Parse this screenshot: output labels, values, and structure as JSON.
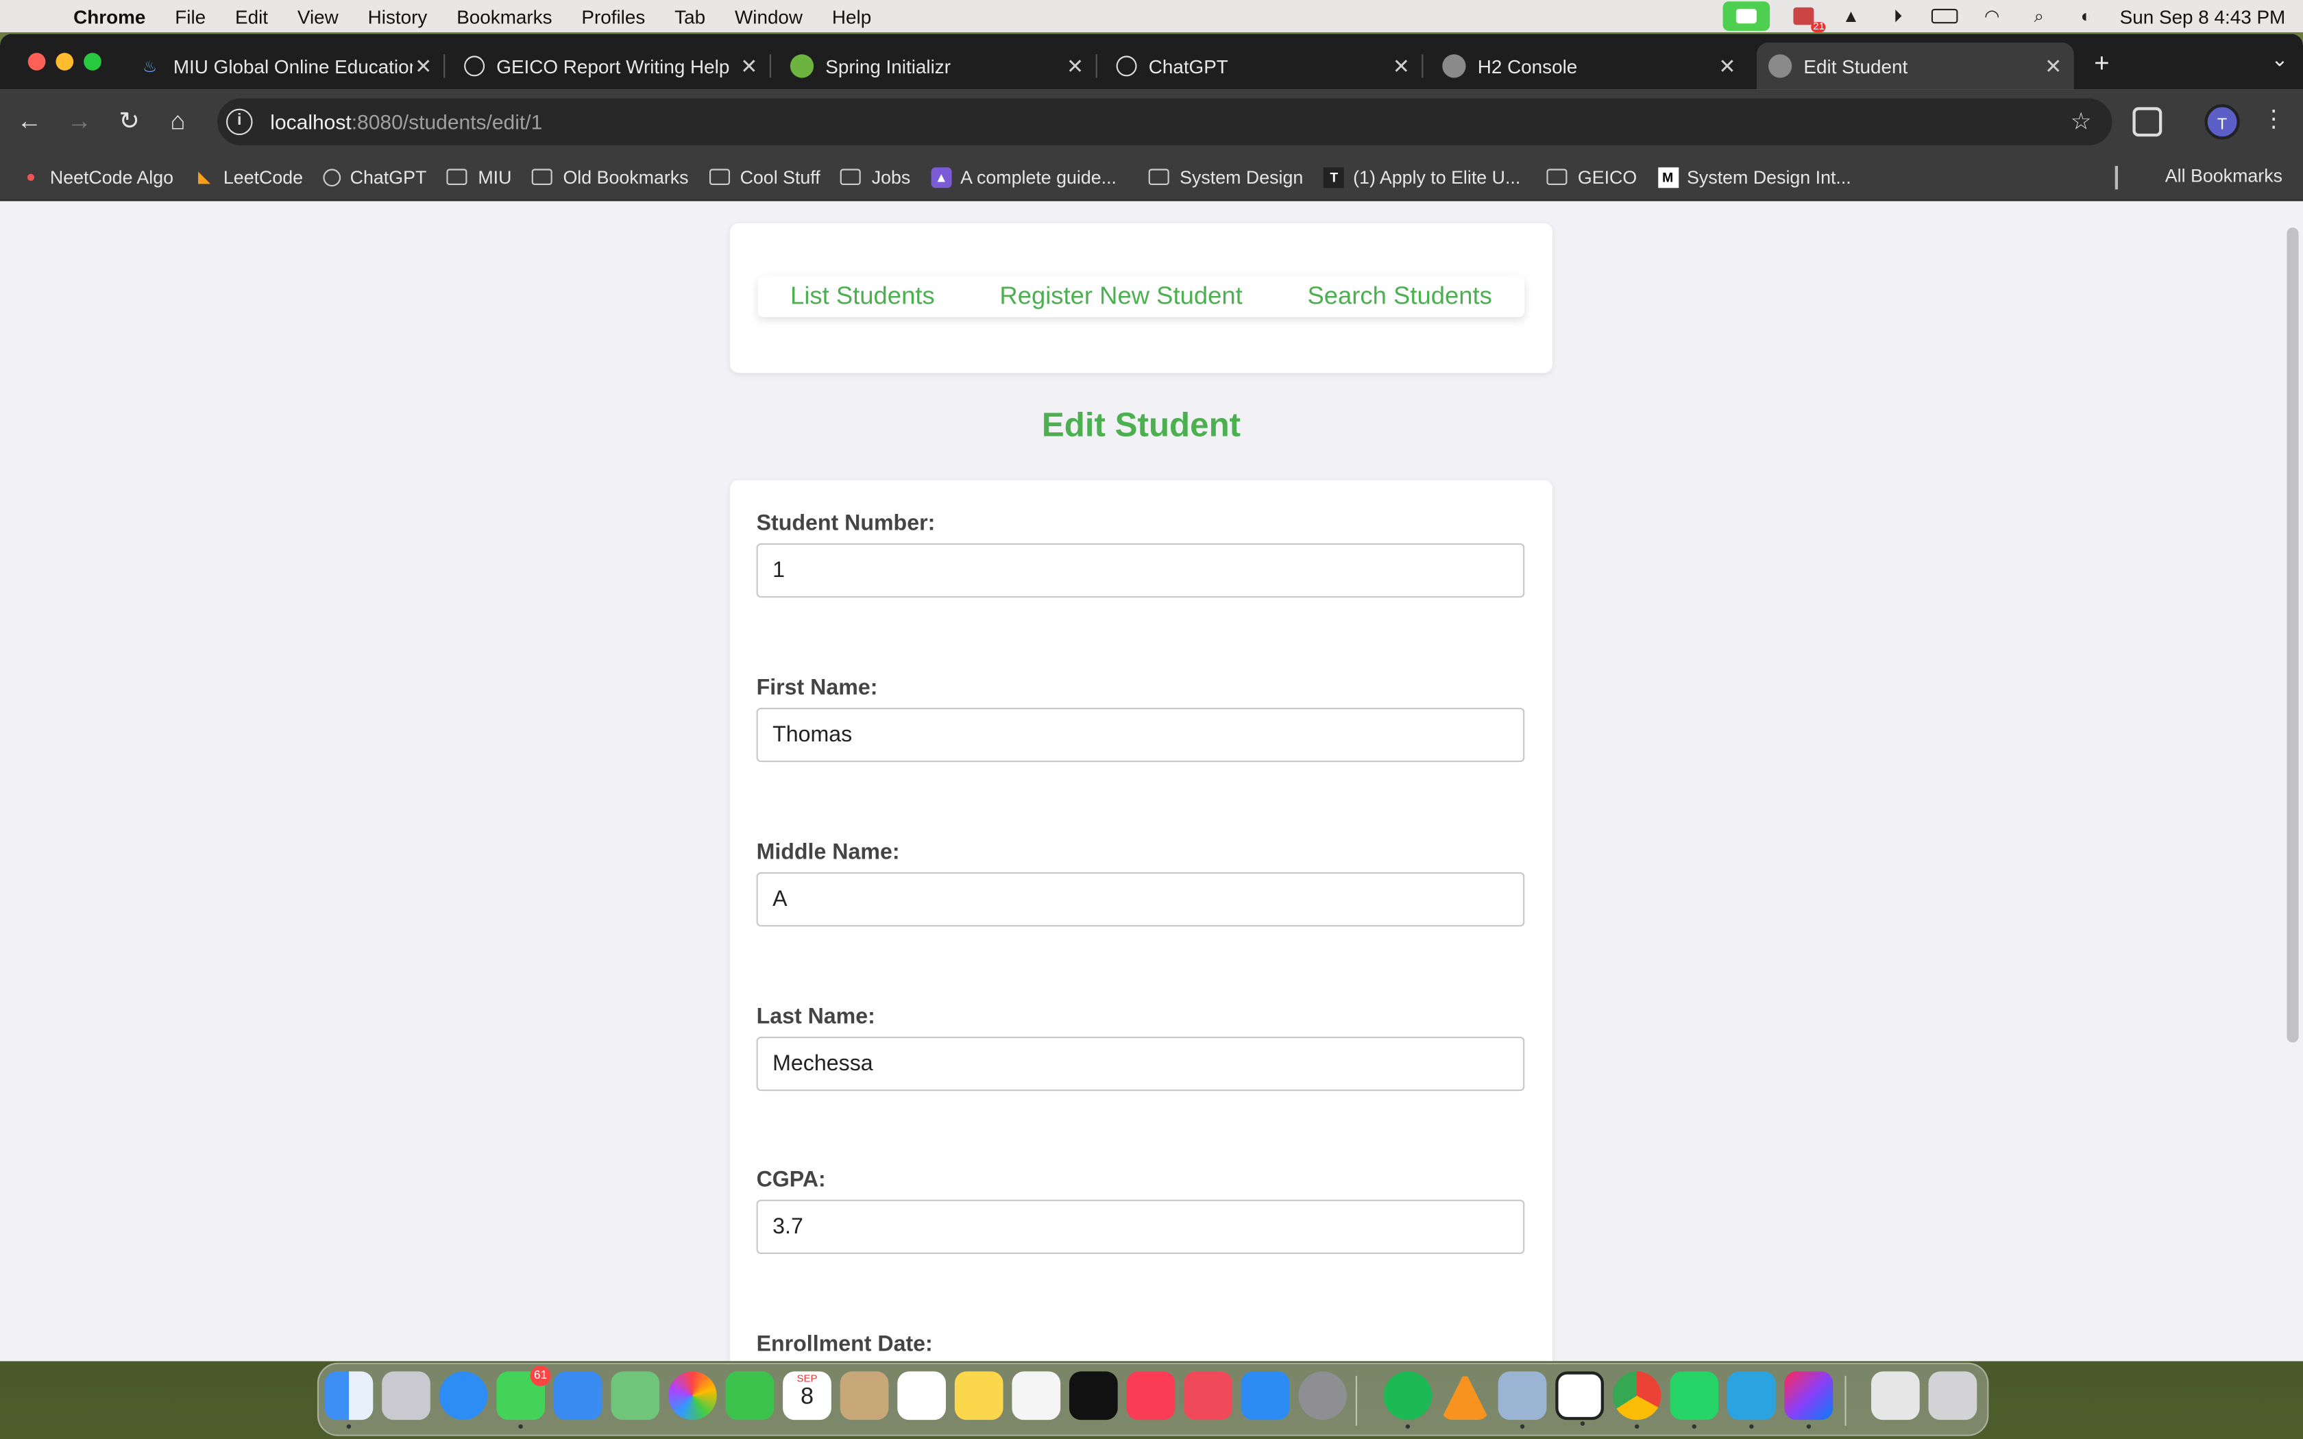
{
  "menubar": {
    "app": "Chrome",
    "items": [
      "File",
      "Edit",
      "View",
      "History",
      "Bookmarks",
      "Profiles",
      "Tab",
      "Window",
      "Help"
    ],
    "clock": "Sun Sep 8  4:43 PM",
    "badge_count": "21"
  },
  "tabs": [
    {
      "title": "MIU Global Online Education",
      "icon": "miu-icon"
    },
    {
      "title": "GEICO Report Writing Help",
      "icon": "chatgpt-icon"
    },
    {
      "title": "Spring Initializr",
      "icon": "spring-icon"
    },
    {
      "title": "ChatGPT",
      "icon": "chatgpt-icon"
    },
    {
      "title": "H2 Console",
      "icon": "globe-icon"
    },
    {
      "title": "Edit Student",
      "icon": "globe-icon",
      "active": true
    }
  ],
  "address": {
    "host": "localhost",
    "path": ":8080/students/edit/1"
  },
  "profile_initial": "T",
  "bookmarks": [
    {
      "label": "NeetCode Algo",
      "icon": "neetcode-icon"
    },
    {
      "label": "LeetCode",
      "icon": "leetcode-icon"
    },
    {
      "label": "ChatGPT",
      "icon": "chatgpt-icon"
    },
    {
      "label": "MIU",
      "icon": "folder-icon"
    },
    {
      "label": "Old Bookmarks",
      "icon": "folder-icon"
    },
    {
      "label": "Cool Stuff",
      "icon": "folder-icon"
    },
    {
      "label": "Jobs",
      "icon": "folder-icon"
    },
    {
      "label": "A complete guide...",
      "icon": "rocket-icon"
    },
    {
      "label": "System Design",
      "icon": "folder-icon"
    },
    {
      "label": "(1) Apply to Elite U...",
      "icon": "elite-icon"
    },
    {
      "label": "GEICO",
      "icon": "folder-icon"
    },
    {
      "label": "System Design Int...",
      "icon": "medium-icon"
    }
  ],
  "all_bookmarks": "All Bookmarks",
  "nav": {
    "list": "List Students",
    "register": "Register New Student",
    "search": "Search Students"
  },
  "heading": "Edit Student",
  "form": {
    "student_number": {
      "label": "Student Number:",
      "value": "1"
    },
    "first_name": {
      "label": "First Name:",
      "value": "Thomas"
    },
    "middle_name": {
      "label": "Middle Name:",
      "value": "A"
    },
    "last_name": {
      "label": "Last Name:",
      "value": "Mechessa"
    },
    "cgpa": {
      "label": "CGPA:",
      "value": "3.7"
    },
    "enrollment_date": {
      "label": "Enrollment Date:"
    }
  },
  "dock": {
    "messages_badge": "61",
    "calendar_month": "SEP",
    "calendar_day": "8"
  },
  "colors": {
    "accent_green": "#4caf50",
    "page_bg": "#f2f1f6"
  }
}
